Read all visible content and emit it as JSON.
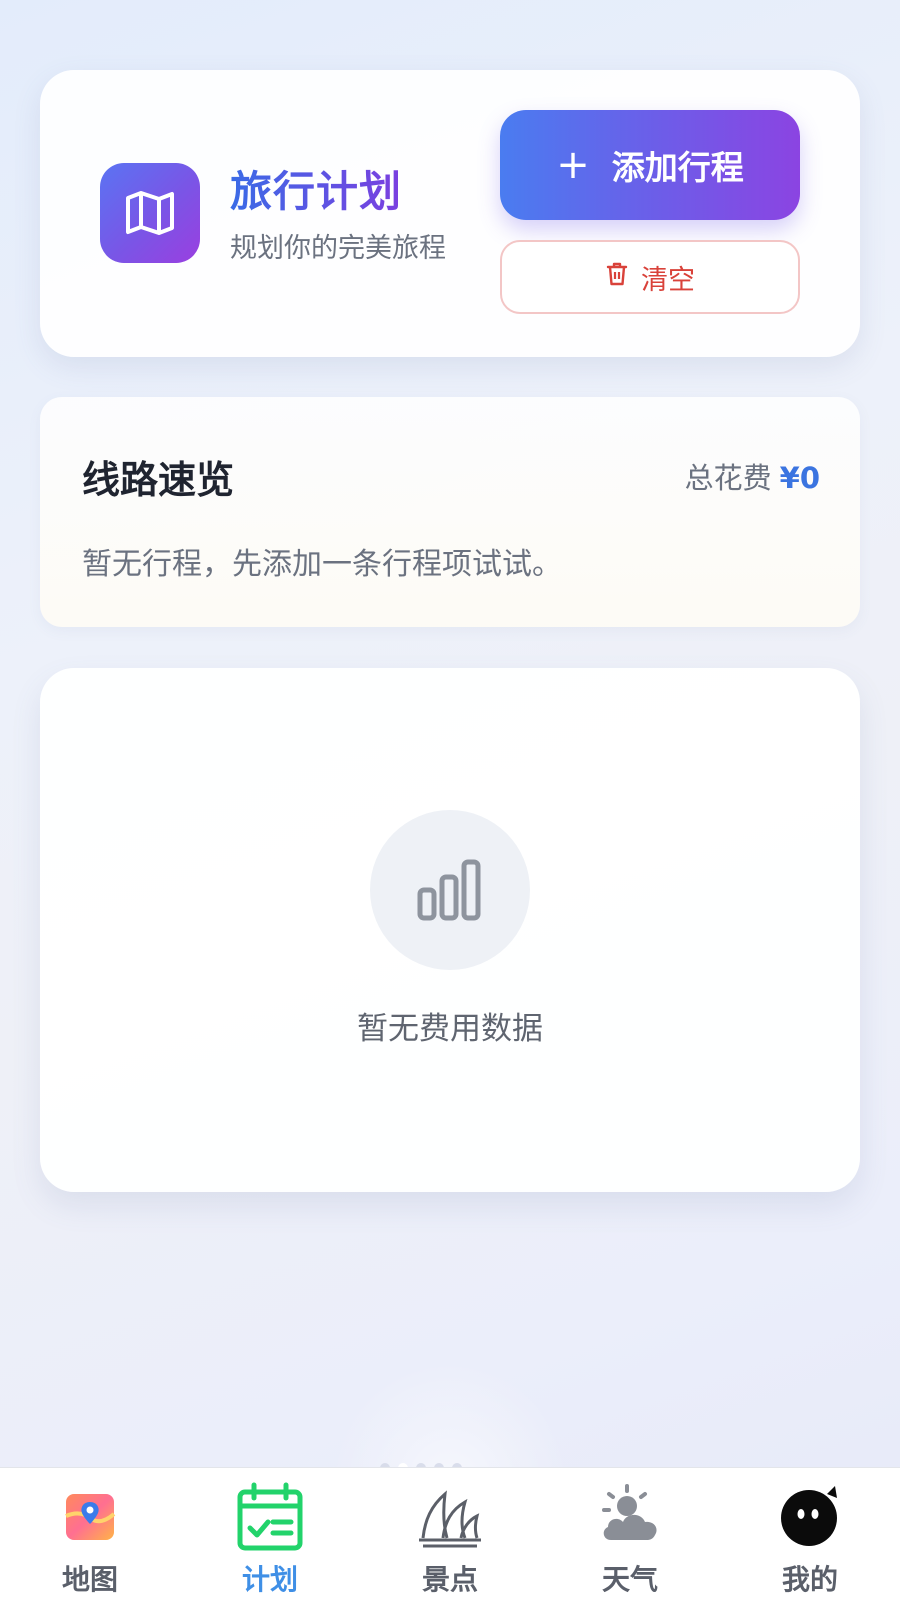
{
  "header": {
    "title": "旅行计划",
    "subtitle": "规划你的完美旅程",
    "app_icon": "map-icon",
    "add_button": {
      "icon": "plus",
      "label": "添加行程"
    },
    "clear_button": {
      "icon": "trash-icon",
      "label": "清空"
    }
  },
  "route_overview": {
    "title": "线路速览",
    "total_label": "总花费",
    "total_value": "¥0",
    "empty_text": "暂无行程，先添加一条行程项试试。"
  },
  "expense_panel": {
    "icon": "bar-chart-icon",
    "empty_text": "暂无费用数据"
  },
  "bottom_nav": {
    "active": "计划",
    "items": [
      {
        "label": "地图",
        "icon": "map-pin-icon"
      },
      {
        "label": "计划",
        "icon": "calendar-check-icon"
      },
      {
        "label": "景点",
        "icon": "opera-house-icon"
      },
      {
        "label": "天气",
        "icon": "sun-cloud-icon"
      },
      {
        "label": "我的",
        "icon": "profile-face-icon"
      }
    ]
  },
  "colors": {
    "accent_blue": "#3b74e0",
    "accent_purple": "#8b44e2",
    "danger": "#d9423a",
    "nav_active": "#3f8fe6",
    "calendar_green": "#22d36b"
  }
}
